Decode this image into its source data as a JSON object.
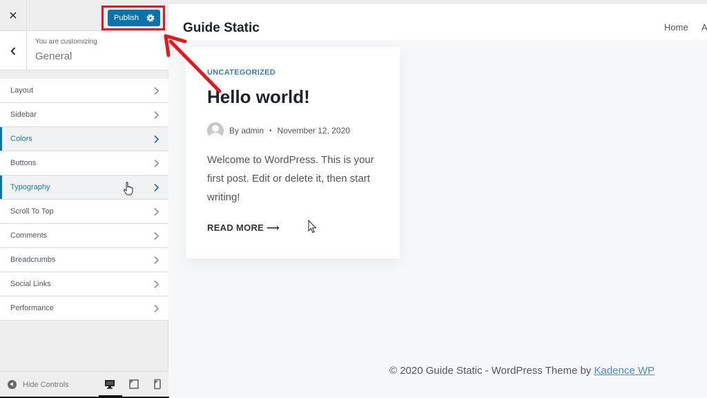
{
  "customizer": {
    "close_label": "✕",
    "publish_label": "Publish",
    "customizing_label": "You are customizing",
    "section_title": "General",
    "back_label": "‹",
    "menu_items": [
      {
        "label": "Layout",
        "active": false
      },
      {
        "label": "Sidebar",
        "active": false
      },
      {
        "label": "Colors",
        "active": true
      },
      {
        "label": "Buttons",
        "active": false
      },
      {
        "label": "Typography",
        "active": true
      },
      {
        "label": "Scroll To Top",
        "active": false
      },
      {
        "label": "Comments",
        "active": false
      },
      {
        "label": "Breadcrumbs",
        "active": false
      },
      {
        "label": "Social Links",
        "active": false
      },
      {
        "label": "Performance",
        "active": false
      }
    ],
    "hide_controls_label": "Hide Controls",
    "devices": [
      "desktop-icon",
      "tablet-icon",
      "mobile-icon"
    ],
    "active_device": "desktop"
  },
  "preview": {
    "site_title": "Guide Static",
    "nav": [
      "Home",
      "A"
    ],
    "post": {
      "category": "UNCATEGORIZED",
      "title": "Hello world!",
      "author": "By admin",
      "separator": "•",
      "date": "November 12, 2020",
      "excerpt": "Welcome to WordPress. This is your first post. Edit or delete it, then start writing!",
      "read_more": "READ MORE ⟶"
    },
    "footer": {
      "text": "© 2020 Guide Static - WordPress Theme by ",
      "link": "Kadence WP"
    }
  },
  "colors": {
    "accent": "#0a73aa",
    "annotation_red": "#e8151b",
    "category_blue": "#3d7ab8",
    "link_blue": "#4b8bc8"
  }
}
